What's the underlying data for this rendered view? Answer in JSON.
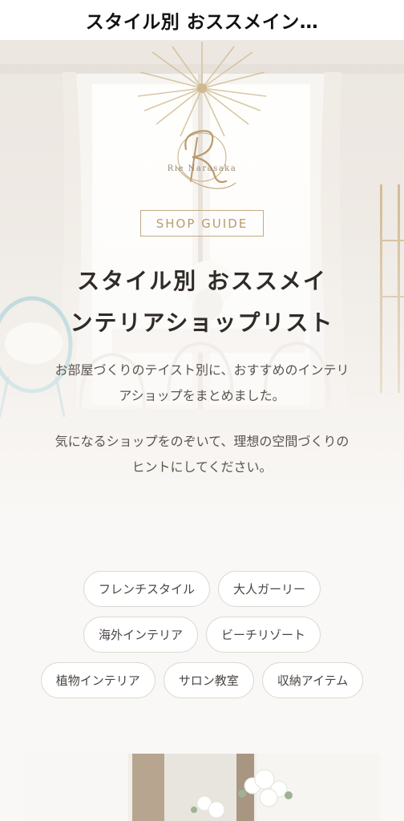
{
  "header": {
    "title": "スタイル別 おススメイン…"
  },
  "hero": {
    "logo_text": "Rie Narasaka",
    "badge": "SHOP GUIDE",
    "title_line1": "スタイル別 おススメイ",
    "title_line2": "ンテリアショップリスト",
    "desc1_line1": "お部屋づくりのテイスト別に、おすすめのインテリ",
    "desc1_line2": "アショップをまとめました。",
    "desc2_line1": "気になるショップをのぞいて、理想の空間づくりの",
    "desc2_line2": "ヒントにしてください。"
  },
  "tags": [
    "フレンチスタイル",
    "大人ガーリー",
    "海外インテリア",
    "ビーチリゾート",
    "植物インテリア",
    "サロン教室",
    "収納アイテム"
  ],
  "colors": {
    "accent_gold": "#c4aa82",
    "text_dark": "#2f2b28",
    "page_bg": "#faf8f6"
  }
}
